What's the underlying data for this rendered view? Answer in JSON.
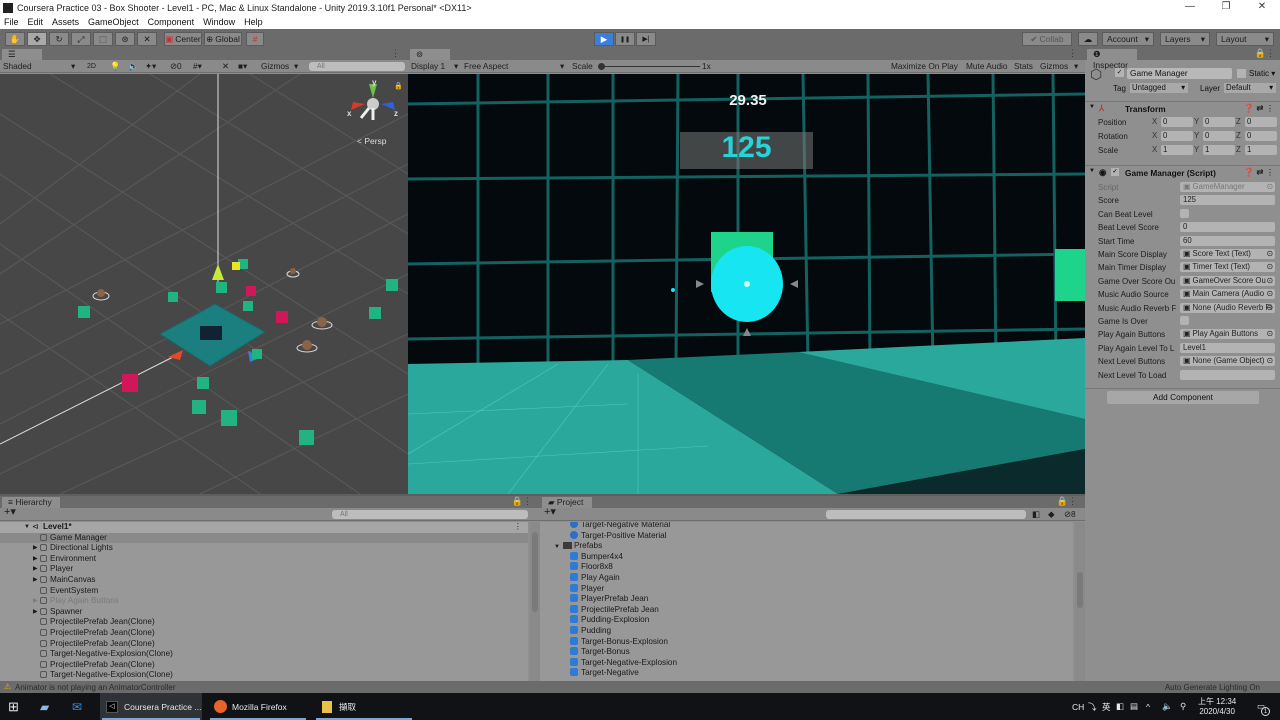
{
  "window": {
    "title": "Coursera Practice 03 - Box Shooter - Level1 - PC, Mac & Linux Standalone - Unity 2019.3.10f1 Personal* <DX11>",
    "minimize": "—",
    "maximize": "❐",
    "close": "✕"
  },
  "menu": [
    "File",
    "Edit",
    "Assets",
    "GameObject",
    "Component",
    "Window",
    "Help"
  ],
  "toolbar": {
    "tools": [
      "hand-tool",
      "move-tool",
      "rotate-tool",
      "scale-tool",
      "rect-tool",
      "transform-tool",
      "custom-tool"
    ],
    "pivot": "Center",
    "space": "Global",
    "play": "▶",
    "pause": "❚❚",
    "step": "▶|",
    "collab": "Collab",
    "account": "Account",
    "layers": "Layers",
    "layout": "Layout"
  },
  "scene": {
    "tab": "Scene",
    "shading": "Shaded",
    "mode_2d": "2D",
    "hidden_count": "0",
    "gizmos": "Gizmos",
    "search_placeholder": "All",
    "projection": "Persp",
    "axis_x": "x",
    "axis_y": "y",
    "axis_z": "z"
  },
  "game": {
    "tab": "Game",
    "display": "Display 1",
    "aspect": "Free Aspect",
    "scale_label": "Scale",
    "scale_value": "1x",
    "maximize_on_play": "Maximize On Play",
    "mute_audio": "Mute Audio",
    "stats": "Stats",
    "gizmos": "Gizmos",
    "timer": "29.35",
    "score": "125"
  },
  "inspector": {
    "tab": "Inspector",
    "object_name": "Game Manager",
    "active": true,
    "static_label": "Static",
    "tag_label": "Tag",
    "tag_value": "Untagged",
    "layer_label": "Layer",
    "layer_value": "Default",
    "transform": {
      "title": "Transform",
      "rows": [
        {
          "label": "Position",
          "x": "0",
          "y": "0",
          "z": "0"
        },
        {
          "label": "Rotation",
          "x": "0",
          "y": "0",
          "z": "0"
        },
        {
          "label": "Scale",
          "x": "1",
          "y": "1",
          "z": "1"
        }
      ]
    },
    "script": {
      "title": "Game Manager (Script)",
      "fields": [
        {
          "label": "Script",
          "value": "GameManager",
          "type": "ref"
        },
        {
          "label": "Score",
          "value": "125",
          "type": "text"
        },
        {
          "label": "Can Beat Level",
          "value": "",
          "type": "check"
        },
        {
          "label": "Beat Level Score",
          "value": "0",
          "type": "text"
        },
        {
          "label": "Start Time",
          "value": "60",
          "type": "text"
        },
        {
          "label": "Main Score Display",
          "value": "Score Text (Text)",
          "type": "ref"
        },
        {
          "label": "Main Timer Display",
          "value": "Timer Text (Text)",
          "type": "ref"
        },
        {
          "label": "Game Over Score Ou",
          "value": "GameOver Score Ou",
          "type": "ref"
        },
        {
          "label": "Music Audio Source",
          "value": "Main Camera (Audio",
          "type": "ref"
        },
        {
          "label": "Music Audio Reverb F",
          "value": "None (Audio Reverb Fi",
          "type": "ref"
        },
        {
          "label": "Game Is Over",
          "value": "",
          "type": "check"
        },
        {
          "label": "Play Again Buttons",
          "value": "Play Again Buttons",
          "type": "ref"
        },
        {
          "label": "Play Again Level To L",
          "value": "Level1",
          "type": "text"
        },
        {
          "label": "Next Level Buttons",
          "value": "None (Game Object)",
          "type": "ref"
        },
        {
          "label": "Next Level To Load",
          "value": "",
          "type": "text"
        }
      ]
    },
    "add_component": "Add Component"
  },
  "hierarchy": {
    "tab": "Hierarchy",
    "search_placeholder": "All",
    "scene_name": "Level1*",
    "items": [
      {
        "label": "Game Manager",
        "expandable": false,
        "selected": true,
        "disabled": false
      },
      {
        "label": "Directional Lights",
        "expandable": true,
        "selected": false,
        "disabled": false
      },
      {
        "label": "Environment",
        "expandable": true,
        "selected": false,
        "disabled": false
      },
      {
        "label": "Player",
        "expandable": true,
        "selected": false,
        "disabled": false
      },
      {
        "label": "MainCanvas",
        "expandable": true,
        "selected": false,
        "disabled": false
      },
      {
        "label": "EventSystem",
        "expandable": false,
        "selected": false,
        "disabled": false
      },
      {
        "label": "Play Again Buttons",
        "expandable": true,
        "selected": false,
        "disabled": true
      },
      {
        "label": "Spawner",
        "expandable": true,
        "selected": false,
        "disabled": false
      },
      {
        "label": "ProjectilePrefab Jean(Clone)",
        "expandable": false,
        "selected": false,
        "disabled": false
      },
      {
        "label": "ProjectilePrefab Jean(Clone)",
        "expandable": false,
        "selected": false,
        "disabled": false
      },
      {
        "label": "ProjectilePrefab Jean(Clone)",
        "expandable": false,
        "selected": false,
        "disabled": false
      },
      {
        "label": "Target-Negative-Explosion(Clone)",
        "expandable": false,
        "selected": false,
        "disabled": false
      },
      {
        "label": "ProjectilePrefab Jean(Clone)",
        "expandable": false,
        "selected": false,
        "disabled": false
      },
      {
        "label": "Target-Negative-Explosion(Clone)",
        "expandable": false,
        "selected": false,
        "disabled": false
      }
    ]
  },
  "project": {
    "tab": "Project",
    "hidden_count": "8",
    "items": [
      {
        "label": "Target-Negative Material",
        "kind": "material",
        "indent": 1
      },
      {
        "label": "Target-Positive Material",
        "kind": "material",
        "indent": 1
      },
      {
        "label": "Prefabs",
        "kind": "folder",
        "indent": 0
      },
      {
        "label": "Bumper4x4",
        "kind": "prefab",
        "indent": 1
      },
      {
        "label": "Floor8x8",
        "kind": "prefab",
        "indent": 1
      },
      {
        "label": "Play Again",
        "kind": "prefab",
        "indent": 1
      },
      {
        "label": "Player",
        "kind": "prefab",
        "indent": 1
      },
      {
        "label": "PlayerPrefab Jean",
        "kind": "prefab",
        "indent": 1
      },
      {
        "label": "ProjectilePrefab Jean",
        "kind": "prefab",
        "indent": 1
      },
      {
        "label": "Pudding-Explosion",
        "kind": "prefab",
        "indent": 1
      },
      {
        "label": "Pudding",
        "kind": "prefab",
        "indent": 1
      },
      {
        "label": "Target-Bonus-Explosion",
        "kind": "prefab",
        "indent": 1
      },
      {
        "label": "Target-Bonus",
        "kind": "prefab",
        "indent": 1
      },
      {
        "label": "Target-Negative-Explosion",
        "kind": "prefab",
        "indent": 1
      },
      {
        "label": "Target-Negative",
        "kind": "prefab",
        "indent": 1
      }
    ]
  },
  "status": {
    "warning": "Animator is not playing an AnimatorController",
    "lighting": "Auto Generate Lighting On"
  },
  "taskbar": {
    "apps": [
      {
        "label": "Coursera Practice ...",
        "icon": "unity-icon",
        "active": true
      },
      {
        "label": "Mozilla Firefox",
        "icon": "firefox-icon",
        "active": false
      },
      {
        "label": "擷取",
        "icon": "folder-icon",
        "active": false
      }
    ],
    "lang": "CH",
    "ime": "英",
    "time": "上午 12:34",
    "date": "2020/4/30",
    "notifications": "1"
  },
  "colors": {
    "play_accent": "#3a7fd9",
    "score_color": "#27d3d6",
    "grid_teal": "#1b6f6c",
    "floor_teal": "#2aa89b"
  }
}
